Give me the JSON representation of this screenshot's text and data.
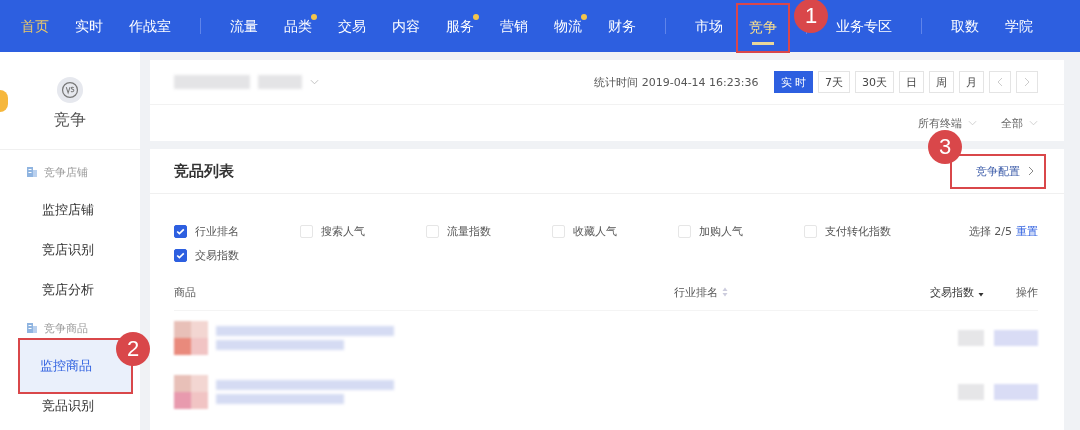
{
  "nav": {
    "groups": [
      [
        {
          "label": "首页",
          "kind": "home",
          "selected": false,
          "dot": false
        },
        {
          "label": "实时",
          "kind": "item",
          "selected": false,
          "dot": false
        },
        {
          "label": "作战室",
          "kind": "item",
          "selected": false,
          "dot": false
        }
      ],
      [
        {
          "label": "流量",
          "kind": "item",
          "selected": false,
          "dot": false
        },
        {
          "label": "品类",
          "kind": "item",
          "selected": false,
          "dot": true
        },
        {
          "label": "交易",
          "kind": "item",
          "selected": false,
          "dot": false
        },
        {
          "label": "内容",
          "kind": "item",
          "selected": false,
          "dot": false
        },
        {
          "label": "服务",
          "kind": "item",
          "selected": false,
          "dot": true
        },
        {
          "label": "营销",
          "kind": "item",
          "selected": false,
          "dot": false
        },
        {
          "label": "物流",
          "kind": "item",
          "selected": false,
          "dot": true
        },
        {
          "label": "财务",
          "kind": "item",
          "selected": false,
          "dot": false
        }
      ],
      [
        {
          "label": "市场",
          "kind": "item",
          "selected": false,
          "dot": false
        },
        {
          "label": "竞争",
          "kind": "item",
          "selected": true,
          "dot": false,
          "annotation": "1"
        }
      ],
      [
        {
          "label": "业务专区",
          "kind": "item",
          "selected": false,
          "dot": false
        }
      ],
      [
        {
          "label": "取数",
          "kind": "item",
          "selected": false,
          "dot": false
        },
        {
          "label": "学院",
          "kind": "item",
          "selected": false,
          "dot": false
        }
      ]
    ]
  },
  "sidebar": {
    "title": "竞争",
    "sections": [
      {
        "label": "竞争店铺",
        "items": [
          {
            "label": "监控店铺",
            "selected": false
          },
          {
            "label": "竞店识别",
            "selected": false
          },
          {
            "label": "竞店分析",
            "selected": false
          }
        ]
      },
      {
        "label": "竞争商品",
        "items": [
          {
            "label": "监控商品",
            "selected": true,
            "annotation": "2"
          },
          {
            "label": "竞品识别",
            "selected": false
          }
        ]
      }
    ]
  },
  "toolbar": {
    "stat_time": "统计时间 2019-04-14 16:23:36",
    "periods": [
      {
        "label": "实 时",
        "selected": true
      },
      {
        "label": "7天",
        "selected": false
      },
      {
        "label": "30天",
        "selected": false
      },
      {
        "label": "日",
        "selected": false
      },
      {
        "label": "周",
        "selected": false
      },
      {
        "label": "月",
        "selected": false
      }
    ],
    "filters": [
      "所有终端",
      "全部"
    ]
  },
  "card": {
    "title": "竞品列表",
    "config_link": {
      "label": "竞争配置",
      "annotation": "3"
    },
    "metrics": [
      {
        "label": "行业排名",
        "checked": true
      },
      {
        "label": "搜索人气",
        "checked": false
      },
      {
        "label": "流量指数",
        "checked": false
      },
      {
        "label": "收藏人气",
        "checked": false
      },
      {
        "label": "加购人气",
        "checked": false
      },
      {
        "label": "支付转化指数",
        "checked": false
      },
      {
        "label": "交易指数",
        "checked": true
      }
    ],
    "selection": "选择 2/5",
    "reset": "重置",
    "columns": [
      {
        "label": "商品"
      },
      {
        "label": "行业排名",
        "sortable": true,
        "sorted_desc": false
      },
      {
        "label": "交易指数",
        "sortable": true,
        "sorted_desc": true
      },
      {
        "label": "操作"
      }
    ],
    "rows": [
      {
        "kind": "blurred",
        "color": "#e98a7c"
      },
      {
        "kind": "blurred",
        "color": "#e89aae"
      }
    ]
  }
}
